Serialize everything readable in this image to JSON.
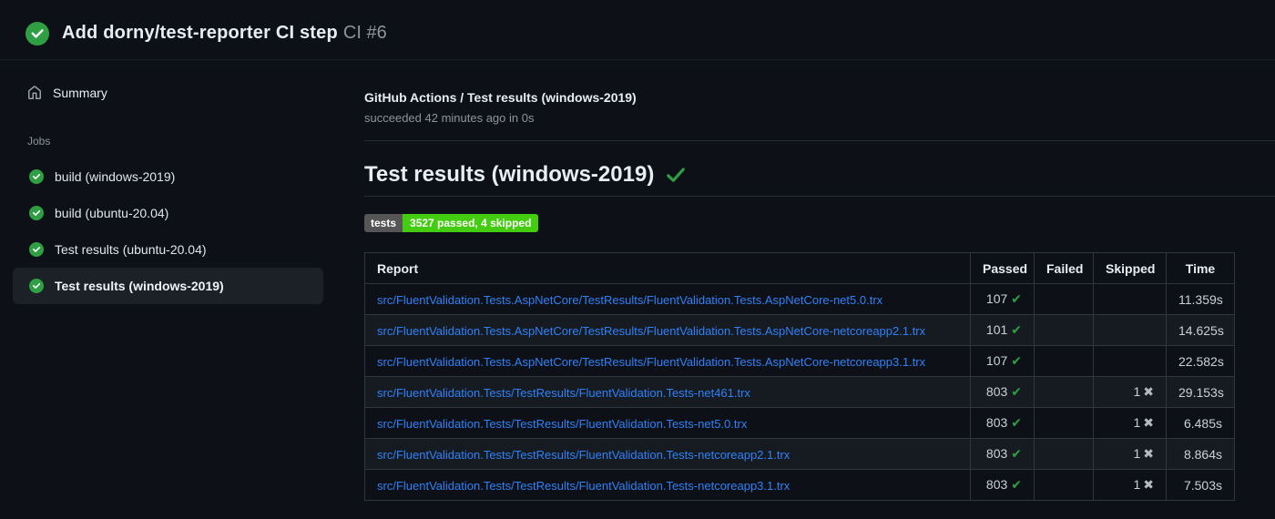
{
  "header": {
    "title": "Add dorny/test-reporter CI step",
    "run_number": "CI #6",
    "status_icon": "check-circle-icon"
  },
  "sidebar": {
    "summary_label": "Summary",
    "jobs_heading": "Jobs",
    "jobs": [
      {
        "label": "build (windows-2019)",
        "status": "success",
        "selected": false
      },
      {
        "label": "build (ubuntu-20.04)",
        "status": "success",
        "selected": false
      },
      {
        "label": "Test results (ubuntu-20.04)",
        "status": "success",
        "selected": false
      },
      {
        "label": "Test results (windows-2019)",
        "status": "success",
        "selected": true
      }
    ]
  },
  "main": {
    "check_title": "GitHub Actions / Test results (windows-2019)",
    "check_status": "succeeded 42 minutes ago in 0s",
    "section_title": "Test results (windows-2019)",
    "section_status_icon": "check-icon",
    "badge": {
      "label": "tests",
      "value": "3527 passed, 4 skipped"
    },
    "table": {
      "headers": [
        "Report",
        "Passed",
        "Failed",
        "Skipped",
        "Time"
      ],
      "rows": [
        {
          "report": "src/FluentValidation.Tests.AspNetCore/TestResults/FluentValidation.Tests.AspNetCore-net5.0.trx",
          "passed": "107",
          "failed": "",
          "skipped": "",
          "time": "11.359s"
        },
        {
          "report": "src/FluentValidation.Tests.AspNetCore/TestResults/FluentValidation.Tests.AspNetCore-netcoreapp2.1.trx",
          "passed": "101",
          "failed": "",
          "skipped": "",
          "time": "14.625s"
        },
        {
          "report": "src/FluentValidation.Tests.AspNetCore/TestResults/FluentValidation.Tests.AspNetCore-netcoreapp3.1.trx",
          "passed": "107",
          "failed": "",
          "skipped": "",
          "time": "22.582s"
        },
        {
          "report": "src/FluentValidation.Tests/TestResults/FluentValidation.Tests-net461.trx",
          "passed": "803",
          "failed": "",
          "skipped": "1",
          "time": "29.153s"
        },
        {
          "report": "src/FluentValidation.Tests/TestResults/FluentValidation.Tests-net5.0.trx",
          "passed": "803",
          "failed": "",
          "skipped": "1",
          "time": "6.485s"
        },
        {
          "report": "src/FluentValidation.Tests/TestResults/FluentValidation.Tests-netcoreapp2.1.trx",
          "passed": "803",
          "failed": "",
          "skipped": "1",
          "time": "8.864s"
        },
        {
          "report": "src/FluentValidation.Tests/TestResults/FluentValidation.Tests-netcoreapp3.1.trx",
          "passed": "803",
          "failed": "",
          "skipped": "1",
          "time": "7.503s"
        }
      ]
    }
  },
  "colors": {
    "page_bg": "#0d1117",
    "row_alt_bg": "#161b22",
    "selected_item_bg": "#1c2128",
    "border": "#30363d",
    "text_primary": "#e6edf3",
    "text_secondary": "#8b949e",
    "link": "#2f81f7",
    "success_green": "#2ea043",
    "badge_label_bg": "#555555",
    "badge_value_bg": "#44cc11",
    "skip_cross": "#b4bac2"
  }
}
